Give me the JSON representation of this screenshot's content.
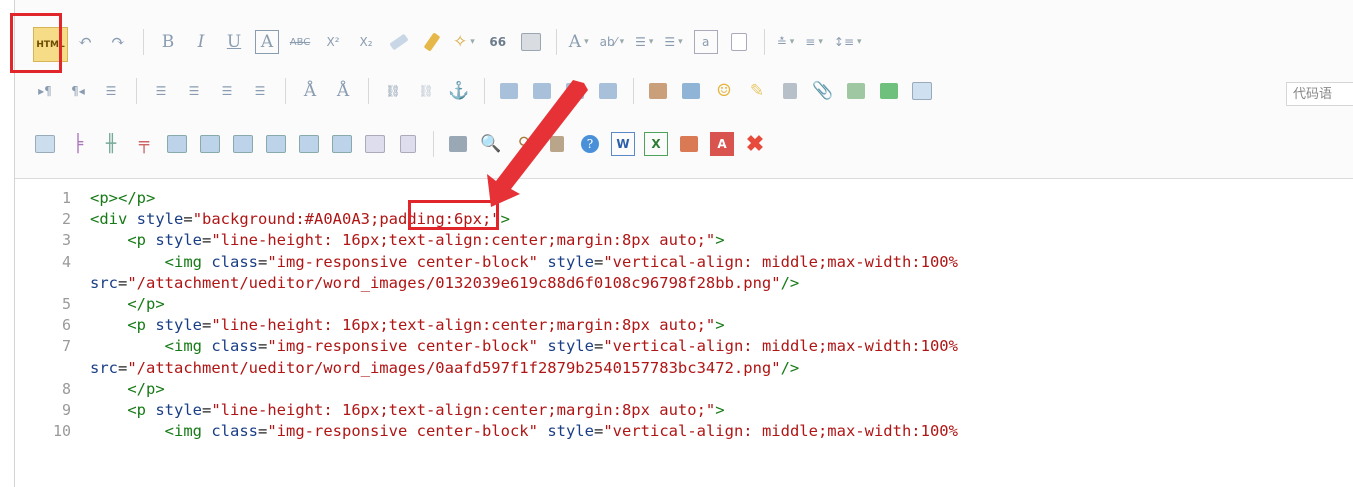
{
  "toolbar": {
    "html_label": "HTML",
    "code_input_placeholder": "代码语",
    "row1": [
      "undo-icon",
      "redo-icon",
      "|",
      "bold-icon",
      "italic-icon",
      "underline-icon",
      "fontborder-icon",
      "strikethrough-icon",
      "superscript-icon",
      "subscript-icon",
      "removeformat-icon",
      "formatmatch-icon",
      "autotypeset-icon",
      "blockquote-icon",
      "pasteplain-icon",
      "|",
      "forecolor-icon",
      "backcolor-icon",
      "insertorderedlist-icon",
      "insertunorderedlist-icon",
      "selectall-icon",
      "cleardoc-icon",
      "|",
      "rowspacingtop-icon",
      "rowspacingbottom-icon",
      "lineheight-icon"
    ],
    "row1_glyphs": {
      "bold": "B",
      "italic": "I",
      "underline": "U",
      "fontborder": "A",
      "strike": "ABC",
      "sup": "X²",
      "sub": "X₂",
      "quote": "66",
      "forecolor": "A",
      "backcolor": "ab⁄"
    },
    "row2": [
      "directionalityltr-icon",
      "directionalityrtl-icon",
      "indent-icon",
      "|",
      "justifyleft-icon",
      "justifycenter-icon",
      "justifyright-icon",
      "justifyjustify-icon",
      "|",
      "touppercase-icon",
      "tolowercase-icon",
      "|",
      "link-icon",
      "unlink-icon",
      "anchor-icon",
      "|",
      "imagenone-icon",
      "imageleft-icon",
      "imageright-icon",
      "imagecenter-icon",
      "|",
      "simpleupload-icon",
      "insertimage-icon",
      "emotion-icon",
      "scrawl-icon",
      "insertvideo-icon",
      "attachment-icon",
      "map-icon",
      "gmap-icon",
      "insertframe-icon"
    ],
    "row3": [
      "inserttable-icon",
      "deletetable-icon",
      "insertparagraphbeforetable-icon",
      "insertrow-icon",
      "deleterow-icon",
      "insertcol-icon",
      "deletecol-icon",
      "mergecells-icon",
      "mergeright-icon",
      "mergedown-icon",
      "splittocells-icon",
      "splittorows-icon",
      "splittocols-icon",
      "charts-icon",
      "|",
      "print-icon",
      "preview-icon",
      "searchreplace-icon",
      "drafts-icon",
      "help-icon",
      "word-icon",
      "excel-icon",
      "ppt-icon",
      "pdf-icon",
      "xiumi-icon"
    ]
  },
  "code_lines": [
    {
      "num": "1",
      "segments": [
        {
          "t": "tag",
          "v": "<p></p>"
        }
      ]
    },
    {
      "num": "2",
      "segments": [
        {
          "t": "tag",
          "v": "<div "
        },
        {
          "t": "attr",
          "v": "style"
        },
        {
          "t": "pl",
          "v": "="
        },
        {
          "t": "val",
          "v": "\"background:#A0A0A3;padding:6px;\""
        },
        {
          "t": "tag",
          "v": ">"
        }
      ]
    },
    {
      "num": "3",
      "segments": [
        {
          "t": "pl",
          "v": "    "
        },
        {
          "t": "tag",
          "v": "<p "
        },
        {
          "t": "attr",
          "v": "style"
        },
        {
          "t": "pl",
          "v": "="
        },
        {
          "t": "val",
          "v": "\"line-height: 16px;text-align:center;margin:8px auto;\""
        },
        {
          "t": "tag",
          "v": ">"
        }
      ]
    },
    {
      "num": "4",
      "segments": [
        {
          "t": "pl",
          "v": "        "
        },
        {
          "t": "tag",
          "v": "<img "
        },
        {
          "t": "attr",
          "v": "class"
        },
        {
          "t": "pl",
          "v": "="
        },
        {
          "t": "val",
          "v": "\"img-responsive center-block\""
        },
        {
          "t": "pl",
          "v": " "
        },
        {
          "t": "attr",
          "v": "style"
        },
        {
          "t": "pl",
          "v": "="
        },
        {
          "t": "val",
          "v": "\"vertical-align: middle;max-width:100%"
        }
      ]
    },
    {
      "num": "",
      "segments": [
        {
          "t": "attr",
          "v": "src"
        },
        {
          "t": "pl",
          "v": "="
        },
        {
          "t": "val",
          "v": "\"/attachment/ueditor/word_images/0132039e619c88d6f0108c96798f28bb.png\""
        },
        {
          "t": "tag",
          "v": "/>"
        }
      ]
    },
    {
      "num": "5",
      "segments": [
        {
          "t": "pl",
          "v": "    "
        },
        {
          "t": "tag",
          "v": "</p>"
        }
      ]
    },
    {
      "num": "6",
      "segments": [
        {
          "t": "pl",
          "v": "    "
        },
        {
          "t": "tag",
          "v": "<p "
        },
        {
          "t": "attr",
          "v": "style"
        },
        {
          "t": "pl",
          "v": "="
        },
        {
          "t": "val",
          "v": "\"line-height: 16px;text-align:center;margin:8px auto;\""
        },
        {
          "t": "tag",
          "v": ">"
        }
      ]
    },
    {
      "num": "7",
      "segments": [
        {
          "t": "pl",
          "v": "        "
        },
        {
          "t": "tag",
          "v": "<img "
        },
        {
          "t": "attr",
          "v": "class"
        },
        {
          "t": "pl",
          "v": "="
        },
        {
          "t": "val",
          "v": "\"img-responsive center-block\""
        },
        {
          "t": "pl",
          "v": " "
        },
        {
          "t": "attr",
          "v": "style"
        },
        {
          "t": "pl",
          "v": "="
        },
        {
          "t": "val",
          "v": "\"vertical-align: middle;max-width:100%"
        }
      ]
    },
    {
      "num": "",
      "segments": [
        {
          "t": "attr",
          "v": "src"
        },
        {
          "t": "pl",
          "v": "="
        },
        {
          "t": "val",
          "v": "\"/attachment/ueditor/word_images/0aafd597f1f2879b2540157783bc3472.png\""
        },
        {
          "t": "tag",
          "v": "/>"
        }
      ]
    },
    {
      "num": "8",
      "segments": [
        {
          "t": "pl",
          "v": "    "
        },
        {
          "t": "tag",
          "v": "</p>"
        }
      ]
    },
    {
      "num": "9",
      "segments": [
        {
          "t": "pl",
          "v": "    "
        },
        {
          "t": "tag",
          "v": "<p "
        },
        {
          "t": "attr",
          "v": "style"
        },
        {
          "t": "pl",
          "v": "="
        },
        {
          "t": "val",
          "v": "\"line-height: 16px;text-align:center;margin:8px auto;\""
        },
        {
          "t": "tag",
          "v": ">"
        }
      ]
    },
    {
      "num": "10",
      "segments": [
        {
          "t": "pl",
          "v": "        "
        },
        {
          "t": "tag",
          "v": "<img "
        },
        {
          "t": "attr",
          "v": "class"
        },
        {
          "t": "pl",
          "v": "="
        },
        {
          "t": "val",
          "v": "\"img-responsive center-block\""
        },
        {
          "t": "pl",
          "v": " "
        },
        {
          "t": "attr",
          "v": "style"
        },
        {
          "t": "pl",
          "v": "="
        },
        {
          "t": "val",
          "v": "\"vertical-align: middle;max-width:100%"
        }
      ]
    }
  ],
  "colors": {
    "highlight": "#e0262a",
    "tag": "#167a16",
    "attr": "#1a3e86",
    "value": "#b01515"
  }
}
